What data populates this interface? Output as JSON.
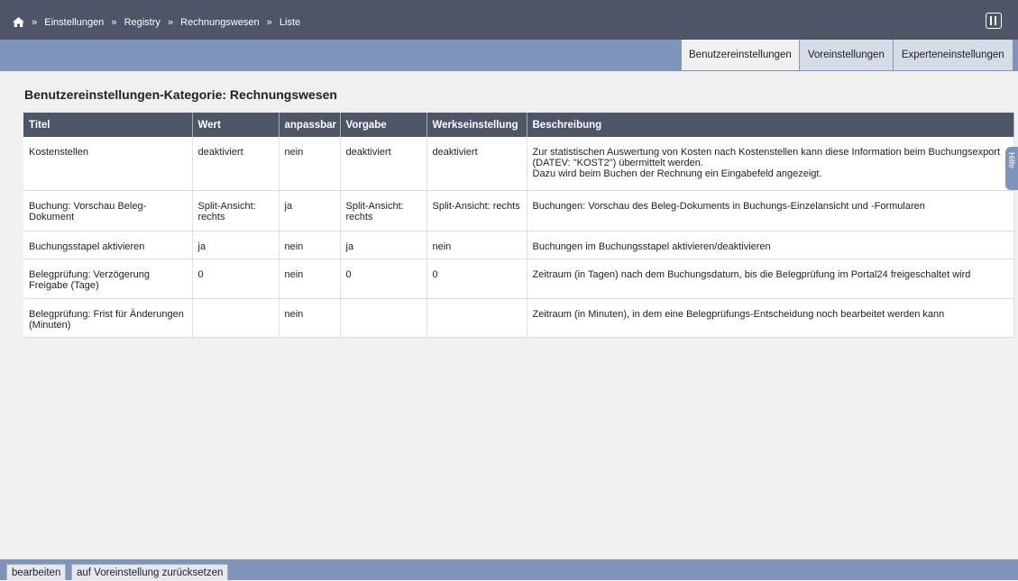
{
  "breadcrumb": {
    "separator": "»",
    "items": [
      "Einstellungen",
      "Registry",
      "Rechnungswesen",
      "Liste"
    ]
  },
  "tabs": [
    "Benutzereinstellungen",
    "Voreinstellungen",
    "Experteneinstellungen"
  ],
  "side_tab": {
    "label": "Hilfe"
  },
  "page_title": "Benutzereinstellungen-Kategorie: Rechnungswesen",
  "table": {
    "headers": [
      "Titel",
      "Wert",
      "anpassbar",
      "Vorgabe",
      "Werkseinstellung",
      "Beschreibung"
    ],
    "rows": [
      [
        "Kostenstellen",
        "deaktiviert",
        "nein",
        "deaktiviert",
        "deaktiviert",
        "Zur statistischen Auswertung von Kosten nach Kostenstellen kann diese Information beim Buchungsexport (DATEV: \"KOST2\") übermittelt werden.\nDazu wird beim Buchen der Rechnung ein Eingabefeld angezeigt."
      ],
      [
        "Buchung: Vorschau Beleg-Dokument",
        "Split-Ansicht: rechts",
        "ja",
        "Split-Ansicht: rechts",
        "Split-Ansicht: rechts",
        "Buchungen: Vorschau des Beleg-Dokuments in Buchungs-Einzelansicht und -Formularen"
      ],
      [
        "Buchungsstapel aktivieren",
        "ja",
        "nein",
        "ja",
        "nein",
        "Buchungen im Buchungsstapel aktivieren/deaktivieren"
      ],
      [
        "Belegprüfung: Verzögerung Freigabe (Tage)",
        "0",
        "nein",
        "0",
        "0",
        "Zeitraum (in Tagen) nach dem Buchungsdatum, bis die Belegprüfung im Portal24 freigeschaltet wird"
      ],
      [
        "Belegprüfung: Frist für Änderungen (Minuten)",
        "",
        "nein",
        "",
        "",
        "Zeitraum (in Minuten), in dem eine Belegprüfungs-Entscheidung noch bearbeitet werden kann"
      ]
    ]
  },
  "footer": {
    "edit_label": "bearbeiten",
    "reset_label": "auf Voreinstellung zurücksetzen"
  }
}
